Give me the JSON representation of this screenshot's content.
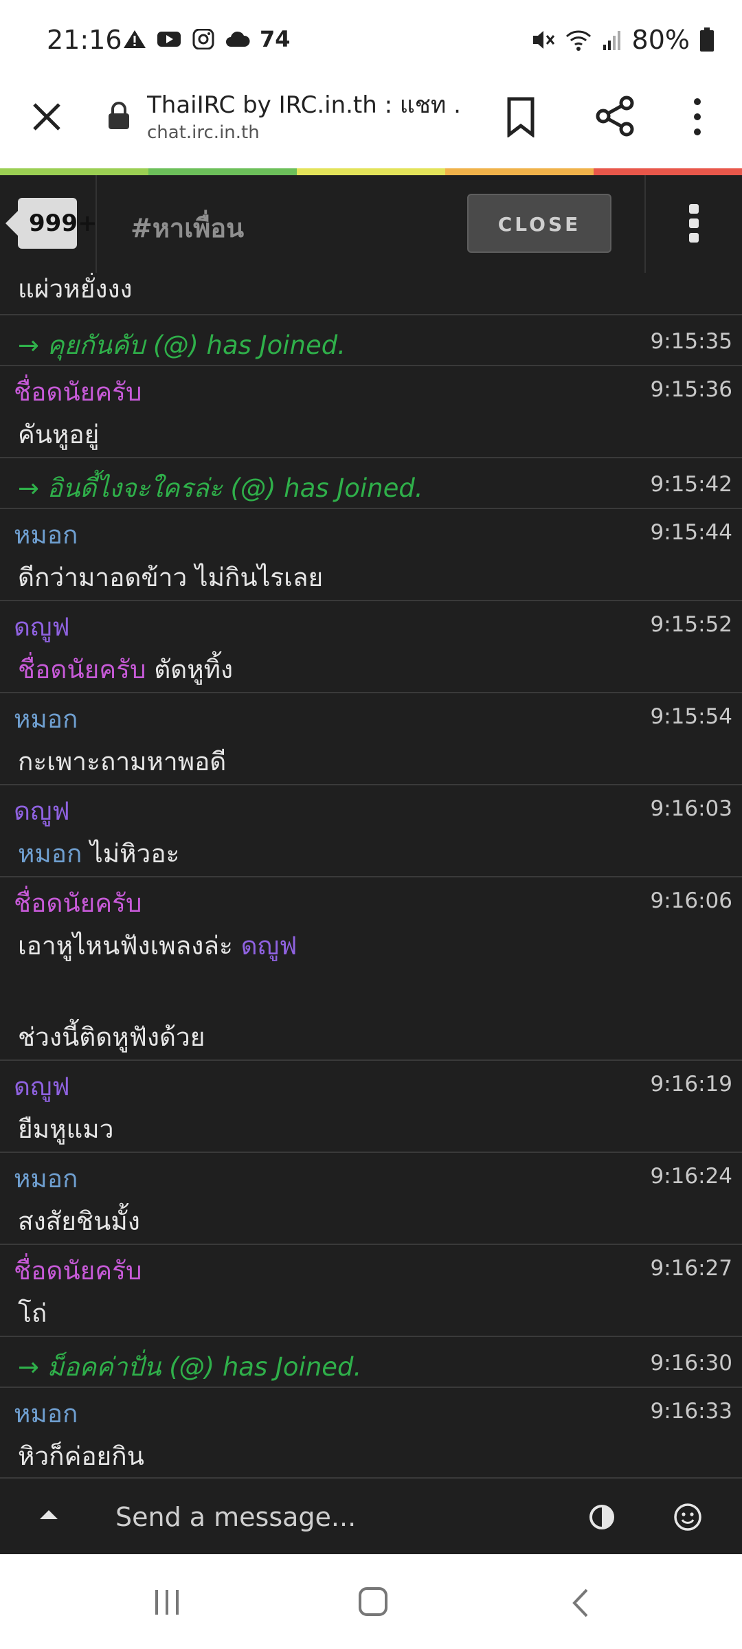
{
  "status_bar": {
    "time": "21:16",
    "notification_count": "74",
    "battery": "80%",
    "icons_left": [
      "warning-icon",
      "youtube-icon",
      "instagram-icon",
      "cloud-icon"
    ],
    "icons_right": [
      "mute-icon",
      "wifi-icon",
      "signal-icon",
      "battery-icon"
    ]
  },
  "browser": {
    "title": "ThaiIRC by IRC.in.th : แชท ...",
    "url": "chat.irc.in.th"
  },
  "chat_header": {
    "unread_badge": "999+",
    "channel": "#หาเพื่อน",
    "close_label": "CLOSE"
  },
  "messages": [
    {
      "type": "msg",
      "nick": "",
      "time": "",
      "text": "แผ่วหยั่งงง"
    },
    {
      "type": "join",
      "text": "→ คุยกันคับ (@) has Joined.",
      "time": "9:15:35"
    },
    {
      "type": "msg",
      "nick": "ชื่อดนัยครับ",
      "nick_color": "pink",
      "time": "9:15:36",
      "text": "คันหูอยู่"
    },
    {
      "type": "join",
      "text": "→ อินดี้ไงจะใครล่ะ (@) has Joined.",
      "time": "9:15:42"
    },
    {
      "type": "msg",
      "nick": "หมอก",
      "nick_color": "blue",
      "time": "9:15:44",
      "text": "ดีกว่ามาอดข้าว  ไม่กินไรเลย"
    },
    {
      "type": "msg",
      "nick": "ดญูฟ",
      "nick_color": "purple",
      "time": "9:15:52",
      "mention": "ชื่อดนัยครับ",
      "mention_color": "pink",
      "text": " ตัดหูทิ้ง"
    },
    {
      "type": "msg",
      "nick": "หมอก",
      "nick_color": "blue",
      "time": "9:15:54",
      "text": "กะเพาะถามหาพอดี"
    },
    {
      "type": "msg",
      "nick": "ดญูฟ",
      "nick_color": "purple",
      "time": "9:16:03",
      "mention": "หมอก",
      "mention_color": "blue",
      "text": " ไม่หิวอะ"
    },
    {
      "type": "msg",
      "nick": "ชื่อดนัยครับ",
      "nick_color": "pink",
      "time": "9:16:06",
      "text": "เอาหูไหนฟังเพลงล่ะ ",
      "trailing_mention": "ดญูฟ",
      "text2": "ช่วงนี้ติดหูฟังด้วย"
    },
    {
      "type": "msg",
      "nick": "ดญูฟ",
      "nick_color": "purple",
      "time": "9:16:19",
      "text": "ยืมหูแมว"
    },
    {
      "type": "msg",
      "nick": "หมอก",
      "nick_color": "blue",
      "time": "9:16:24",
      "text": "สงสัยชินมั้ง"
    },
    {
      "type": "msg",
      "nick": "ชื่อดนัยครับ",
      "nick_color": "pink",
      "time": "9:16:27",
      "text": "โถ่"
    },
    {
      "type": "join",
      "text": "→ ม็อคค่าปั่น (@) has Joined.",
      "time": "9:16:30"
    },
    {
      "type": "msg",
      "nick": "หมอก",
      "nick_color": "blue",
      "time": "9:16:33",
      "text": "หิวก็ค่อยกิน"
    }
  ],
  "composer": {
    "placeholder": "Send a message..."
  },
  "colors": {
    "nick_pink": "#c75ad8",
    "nick_blue": "#6f9fd0",
    "nick_purple": "#8f62e0",
    "join_green": "#2fb04a",
    "chat_bg": "#1f1f1f",
    "rainbow": [
      "#9bcf53",
      "#6cbf5a",
      "#e3e35a",
      "#f0b24a",
      "#e8574a"
    ]
  }
}
